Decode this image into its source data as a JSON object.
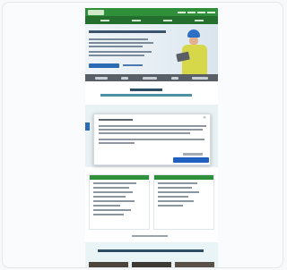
{
  "browser": {},
  "header": {
    "nav": {}
  },
  "hero": {},
  "cookie_dialog": {}
}
